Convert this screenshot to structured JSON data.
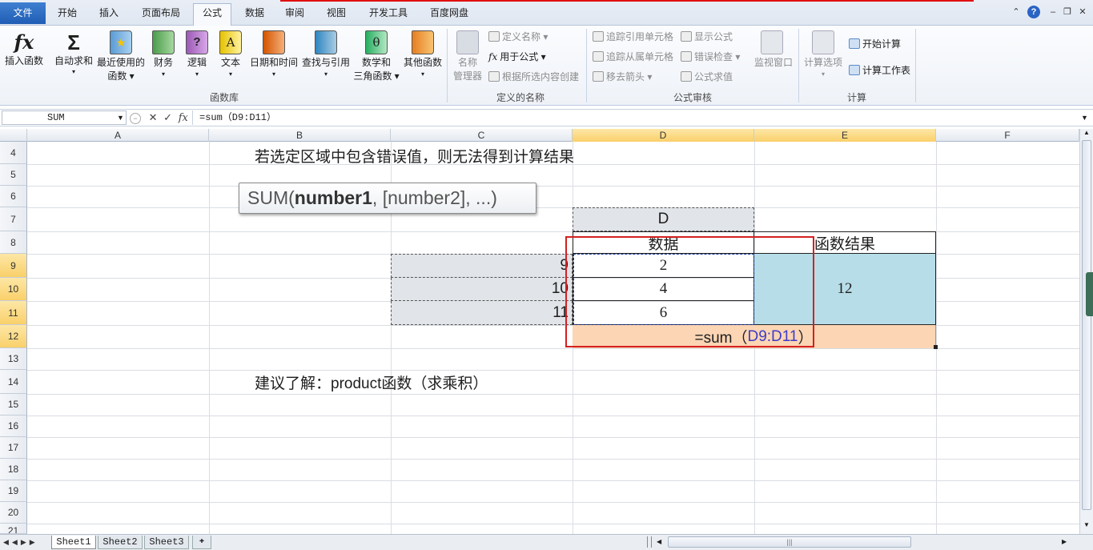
{
  "tabs": [
    "文件",
    "开始",
    "插入",
    "页面布局",
    "公式",
    "数据",
    "审阅",
    "视图",
    "开发工具",
    "百度网盘"
  ],
  "ribbon": {
    "insert_function": "插入函数",
    "autosum": "自动求和",
    "recent_line1": "最近使用的",
    "recent_line2": "函数",
    "financial": "财务",
    "logical": "逻辑",
    "text": "文本",
    "datetime": "日期和时间",
    "lookup": "查找与引用",
    "math_line1": "数学和",
    "math_line2": "三角函数",
    "other": "其他函数",
    "group_library": "函数库",
    "name_manager_line1": "名称",
    "name_manager_line2": "管理器",
    "define_name": "定义名称",
    "use_in_formula": "用于公式",
    "create_from_selection": "根据所选内容创建",
    "group_names": "定义的名称",
    "trace_precedents": "追踪引用单元格",
    "trace_dependents": "追踪从属单元格",
    "remove_arrows": "移去箭头",
    "show_formulas": "显示公式",
    "error_checking": "错误检查",
    "evaluate_formula": "公式求值",
    "watch_window": "监视窗口",
    "group_auditing": "公式审核",
    "calc_options": "计算选项",
    "calc_now": "开始计算",
    "calc_sheet": "计算工作表",
    "group_calc": "计算"
  },
  "formula_bar": {
    "name_box": "SUM",
    "formula": "=sum（D9:D11）"
  },
  "columns": [
    "A",
    "B",
    "C",
    "D",
    "E",
    "F"
  ],
  "rows": [
    "4",
    "5",
    "6",
    "7",
    "8",
    "9",
    "10",
    "11",
    "12",
    "13",
    "14",
    "15",
    "16",
    "17",
    "18",
    "19",
    "20",
    "21"
  ],
  "sheet": {
    "note1": "若选定区域中包含错误值，则无法得到计算结果",
    "tooltip_sum": "SUM(",
    "tooltip_bold": "number1",
    "tooltip_rest": ", [number2], ...)",
    "header_d": "D",
    "header_data": "数据",
    "header_result": "函数结果",
    "c9": "9",
    "c10": "10",
    "c11": "11",
    "d9": "2",
    "d10": "4",
    "d11": "6",
    "result": "12",
    "formula_prefix": "=sum（",
    "formula_ref": "D9:D11",
    "formula_suffix": "）",
    "note2": "建议了解：product函数（求乘积）"
  },
  "sheet_tabs": [
    "Sheet1",
    "Sheet2",
    "Sheet3"
  ]
}
